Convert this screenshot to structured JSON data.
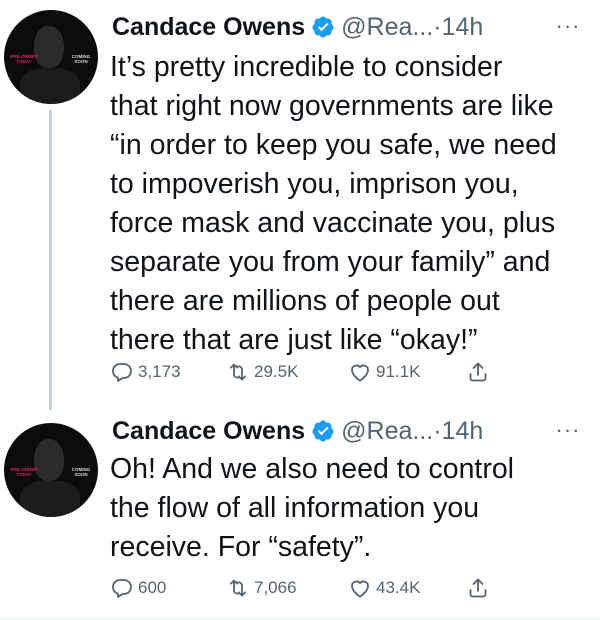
{
  "tweets": [
    {
      "author": {
        "name": "Candace Owens",
        "handle": "@Rea...",
        "verified": true
      },
      "separator": "·",
      "time": "14h",
      "more_label": "···",
      "avatar": {
        "tag_left": "PRE-ORDER TODAY",
        "tag_right": "COMING SOON"
      },
      "text": "It’s pretty incredible to consider\nthat right now governments are like\n“in order to keep you safe, we need\nto impoverish you, imprison you,\nforce mask and vaccinate you, plus\nseparate you from your family” and\nthere are millions of people out\nthere that are just like “okay!”",
      "actions": {
        "replies": "3,173",
        "retweets": "29.5K",
        "likes": "91.1K"
      }
    },
    {
      "author": {
        "name": "Candace Owens",
        "handle": "@Rea...",
        "verified": true
      },
      "separator": "·",
      "time": "14h",
      "more_label": "···",
      "avatar": {
        "tag_left": "PRE-ORDER TODAY",
        "tag_right": "COMING SOON"
      },
      "text": "Oh! And we also need to control\nthe flow of all information you\nreceive. For “safety”.",
      "actions": {
        "replies": "600",
        "retweets": "7,066",
        "likes": "43.4K"
      }
    }
  ],
  "colors": {
    "verified_badge": "#1d9bf0",
    "secondary_text": "#536471",
    "thread_line": "#c4cfd6",
    "avatar_tag_pink": "#e0245e"
  },
  "icons": [
    "reply-icon",
    "retweet-icon",
    "like-icon",
    "share-icon",
    "verified-badge-icon",
    "more-icon"
  ]
}
